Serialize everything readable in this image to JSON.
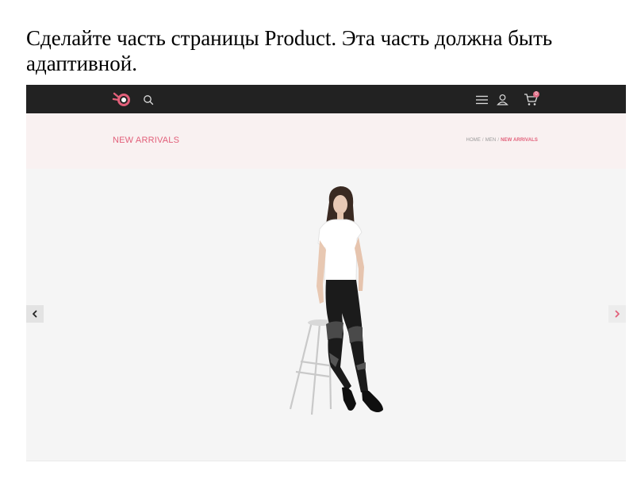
{
  "task": {
    "text": "Сделайте часть страницы Product. Эта часть должна быть адаптивной."
  },
  "header": {
    "logo_icon": "brand-logo-icon",
    "search_icon": "search-icon",
    "menu_icon": "hamburger-menu-icon",
    "user_icon": "user-icon",
    "cart_icon": "cart-icon",
    "cart_count": "0"
  },
  "page": {
    "title": "NEW ARRIVALS",
    "breadcrumb": [
      "HOME",
      "MEN",
      "NEW ARRIVALS"
    ]
  },
  "slider": {
    "image": "model-on-stool-photo",
    "prev_icon": "chevron-left-icon",
    "next_icon": "chevron-right-icon"
  },
  "colors": {
    "accent": "#e2607a",
    "topbar": "#222222",
    "title_band": "#f9f1f1",
    "slider_bg": "#f5f5f5"
  }
}
